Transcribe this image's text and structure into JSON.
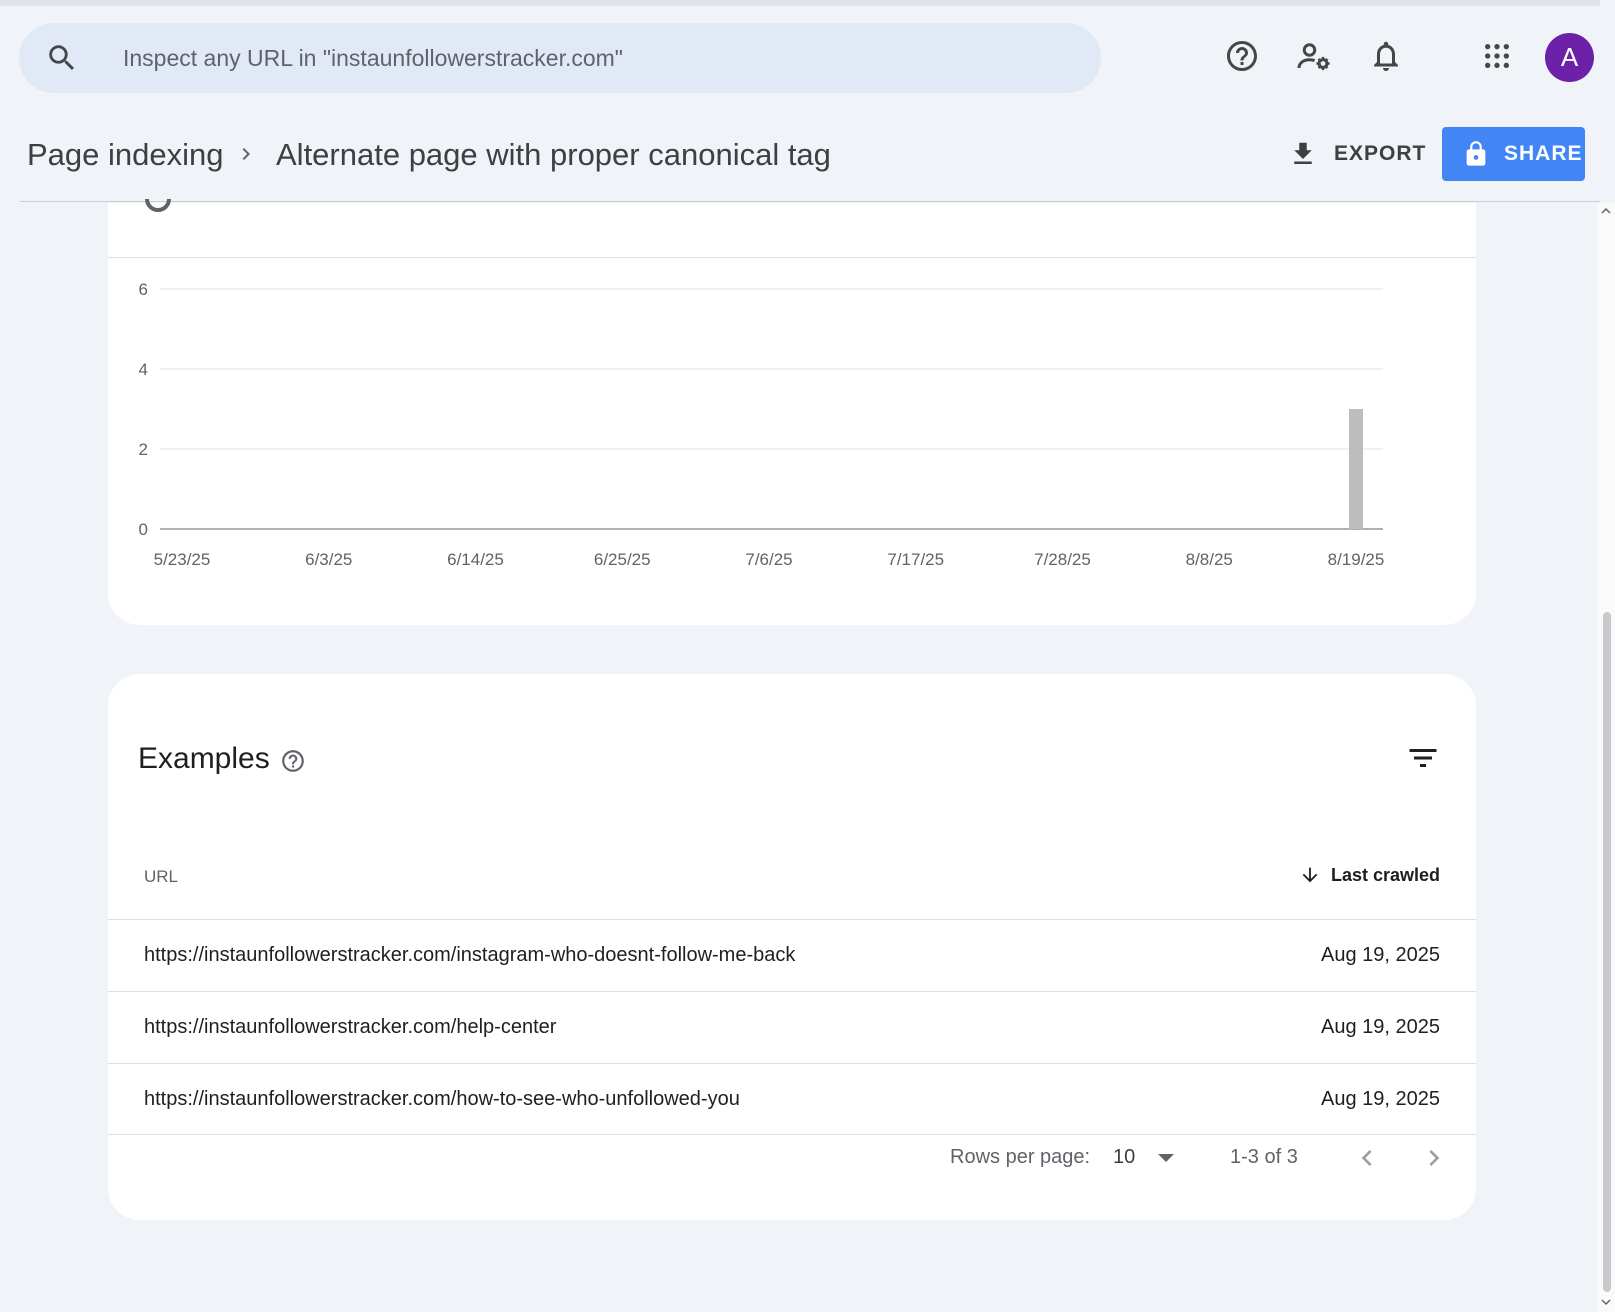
{
  "search": {
    "placeholder": "Inspect any URL in \"instaunfollowerstracker.com\""
  },
  "user": {
    "avatar_initial": "A",
    "avatar_color": "#6c21a8"
  },
  "header": {
    "breadcrumb_parent": "Page indexing",
    "title": "Alternate page with proper canonical tag",
    "export_label": "EXPORT",
    "share_label": "SHARE"
  },
  "chart_data": {
    "type": "bar",
    "title": "",
    "xlabel": "",
    "ylabel": "",
    "ylim": [
      0,
      6
    ],
    "yticks": [
      "0",
      "2",
      "4",
      "6"
    ],
    "xticks": [
      "5/23/25",
      "6/3/25",
      "6/14/25",
      "6/25/25",
      "7/6/25",
      "7/17/25",
      "7/28/25",
      "8/8/25",
      "8/19/25"
    ],
    "x_range": [
      "5/23/25",
      "8/19/25"
    ],
    "grid": true,
    "bar_color": "#bdbdbd",
    "series": [
      {
        "values": [
          {
            "x": "8/19/25",
            "y": 3
          }
        ]
      }
    ]
  },
  "examples": {
    "title": "Examples",
    "columns": {
      "url": "URL",
      "last_crawled": "Last crawled"
    },
    "rows": [
      {
        "url": "https://instaunfollowerstracker.com/instagram-who-doesnt-follow-me-back",
        "last_crawled": "Aug 19, 2025"
      },
      {
        "url": "https://instaunfollowerstracker.com/help-center",
        "last_crawled": "Aug 19, 2025"
      },
      {
        "url": "https://instaunfollowerstracker.com/how-to-see-who-unfollowed-you",
        "last_crawled": "Aug 19, 2025"
      }
    ],
    "pagination": {
      "rows_per_page_label": "Rows per page:",
      "rows_per_page": "10",
      "range": "1-3 of 3"
    }
  }
}
